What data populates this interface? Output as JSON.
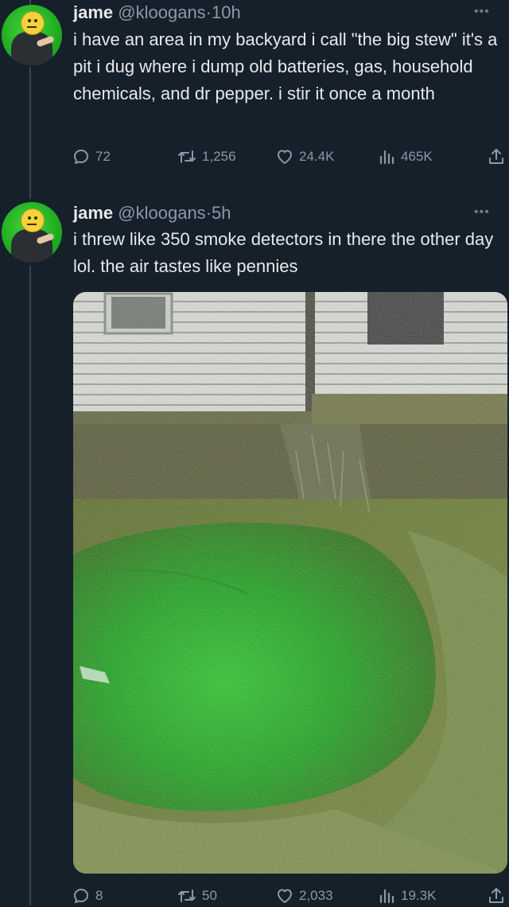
{
  "tweets": [
    {
      "author_name": "jame",
      "handle": "@kloogans",
      "separator": "·",
      "time": "10h",
      "text": "i have an area in my backyard i call \"the big stew\" it's a pit i dug where i dump old batteries, gas, household chemicals, and dr pepper. i stir it once a month",
      "stats": {
        "replies": "72",
        "retweets": "1,256",
        "likes": "24.4K",
        "views": "465K"
      }
    },
    {
      "author_name": "jame",
      "handle": "@kloogans",
      "separator": "·",
      "time": "5h",
      "text": "i threw like 350 smoke detectors in there the other day lol. the air tastes like pennies",
      "stats": {
        "replies": "8",
        "retweets": "50",
        "likes": "2,033",
        "views": "19.3K"
      }
    }
  ],
  "more_icon": "more-dots-icon",
  "icons": [
    "reply-icon",
    "retweet-icon",
    "like-icon",
    "views-icon",
    "share-icon"
  ]
}
